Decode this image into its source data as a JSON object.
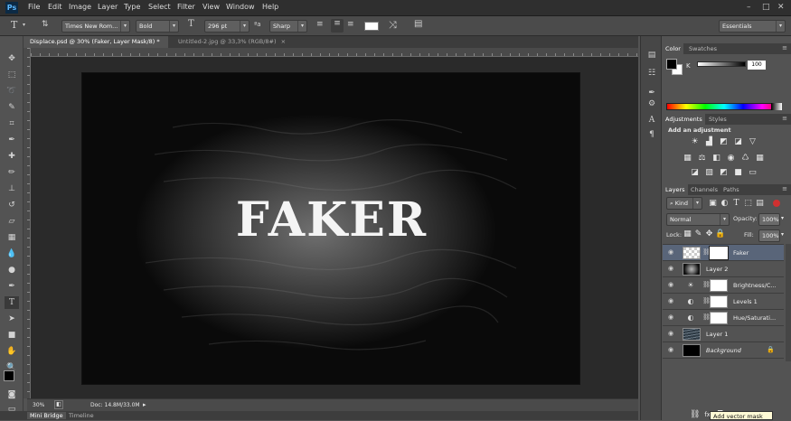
{
  "app": {
    "logo": "Ps"
  },
  "menu": [
    "File",
    "Edit",
    "Image",
    "Layer",
    "Type",
    "Select",
    "Filter",
    "View",
    "Window",
    "Help"
  ],
  "window_controls": {
    "minimize": "–",
    "maximize": "□",
    "close": "✕"
  },
  "options_bar": {
    "font_family": "Times New Rom...",
    "font_style": "Bold",
    "font_size": "296 pt",
    "antialias": "Sharp",
    "workspace": "Essentials",
    "text_color": "#ffffff"
  },
  "doc_tabs": [
    {
      "label": "Displace.psd @ 30% (Faker, Layer Mask/8) *",
      "close": "×",
      "active": true
    },
    {
      "label": "Untitled-2.jpg @ 33,3% (RGB/8#)",
      "close": "×",
      "active": false
    }
  ],
  "canvas": {
    "text": "FAKER"
  },
  "status": {
    "zoom": "30%",
    "doc": "Doc: 14.8M/33.0M"
  },
  "bottom_tabs": [
    "Mini Bridge",
    "Timeline"
  ],
  "color_panel": {
    "tabs": [
      "Color",
      "Swatches"
    ],
    "channel_label": "K",
    "channel_value": "100",
    "foreground": "#000000",
    "background": "#ffffff"
  },
  "adjustments_panel": {
    "tabs": [
      "Adjustments",
      "Styles"
    ],
    "heading": "Add an adjustment"
  },
  "layers_panel": {
    "tabs": [
      "Layers",
      "Channels",
      "Paths"
    ],
    "filter_kind": "Kind",
    "blend_mode": "Normal",
    "opacity_label": "Opacity:",
    "opacity_value": "100%",
    "lock_label": "Lock:",
    "fill_label": "Fill:",
    "fill_value": "100%",
    "layers": [
      {
        "name": "Faker",
        "type": "text-mask",
        "selected": true
      },
      {
        "name": "Layer 2",
        "type": "pixel"
      },
      {
        "name": "Brightness/C...",
        "type": "adjustment-brightness"
      },
      {
        "name": "Levels 1",
        "type": "adjustment-levels"
      },
      {
        "name": "Hue/Saturati...",
        "type": "adjustment-hue"
      },
      {
        "name": "Layer 1",
        "type": "pixel-water"
      },
      {
        "name": "Background",
        "type": "background",
        "locked": true
      }
    ]
  },
  "tooltip": "Add vector mask",
  "colors": {
    "accent_selected_layer": "#596579",
    "panel_bg": "#535353",
    "menubar_bg": "#2f2f2f"
  }
}
